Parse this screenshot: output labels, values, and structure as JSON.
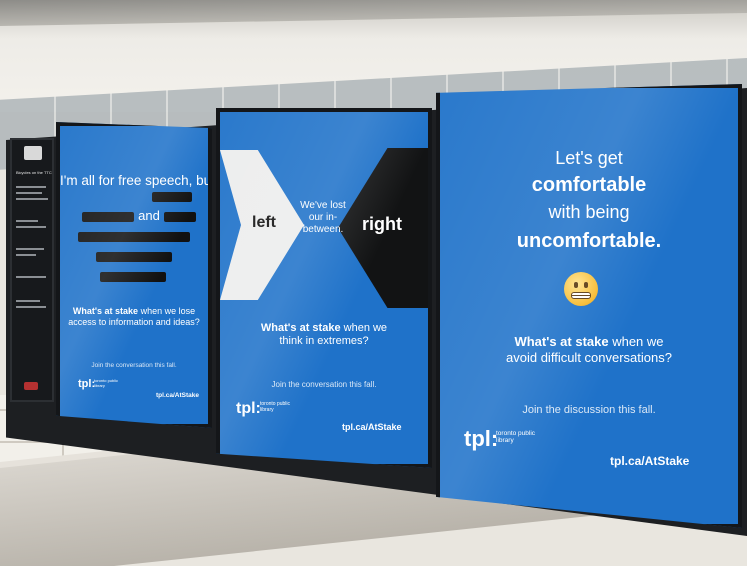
{
  "posters": [
    {
      "headline": "I'm all for free speech, but",
      "redacted_word": "and",
      "stake_bold": "What's at stake",
      "stake_rest_1": " when we lose",
      "stake_rest_2": "access to information and ideas?",
      "join": "Join the conversation this fall.",
      "logo": "tpl:",
      "logo_sub": "toronto public library",
      "url": "tpl.ca/AtStake"
    },
    {
      "left_word": "left",
      "right_word": "right",
      "middle_text": "We've lost our in-between.",
      "stake_bold": "What's at stake",
      "stake_rest_1": " when we",
      "stake_rest_2": "think in extremes?",
      "join": "Join the conversation this fall.",
      "logo": "tpl:",
      "logo_sub": "toronto public library",
      "url": "tpl.ca/AtStake"
    },
    {
      "line1": "Let's get",
      "line2": "comfortable",
      "line3": "with being",
      "line4": "uncomfortable.",
      "emoji": "grimacing-face",
      "stake_bold": "What's at stake",
      "stake_rest_1": " when we",
      "stake_rest_2": "avoid difficult conversations?",
      "join": "Join the discussion this fall.",
      "logo": "tpl:",
      "logo_sub": "toronto public library",
      "url": "tpl.ca/AtStake"
    }
  ],
  "info_panel": {
    "title": "Bicycles on the TTC"
  },
  "colors": {
    "poster_blue": "#1f72c9",
    "frame": "#141619"
  }
}
